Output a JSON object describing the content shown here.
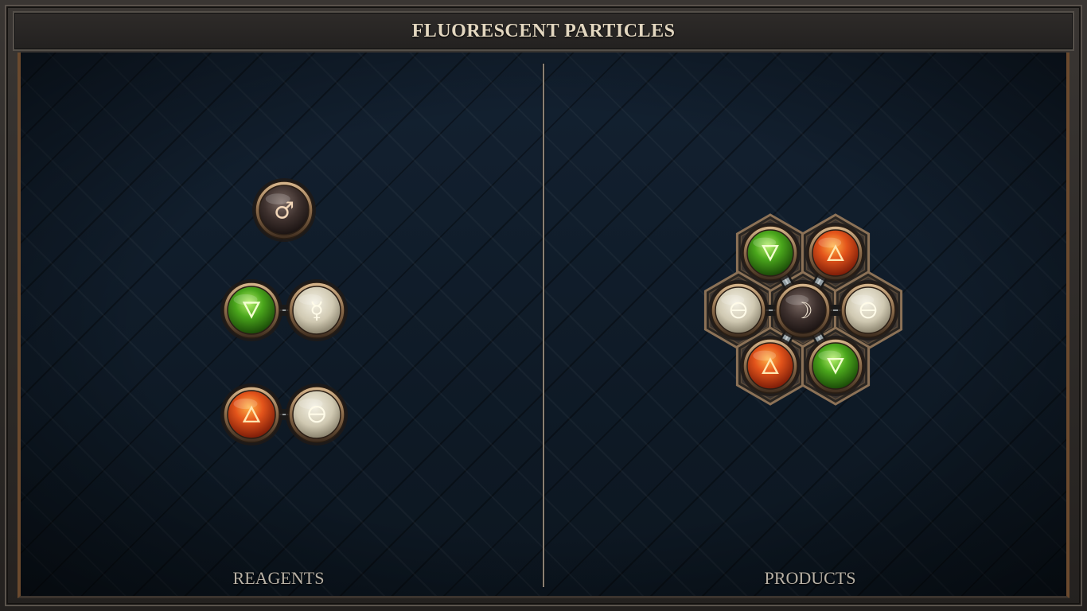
{
  "title": "FLUORESCENT PARTICLES",
  "sections": {
    "reagents_label": "REAGENTS",
    "products_label": "PRODUCTS"
  },
  "colors": {
    "frame": "#2e2b29",
    "board": "#101a25",
    "fire": "#e0531a",
    "water": "#4caa1c",
    "salt": "#d8d2bd",
    "quicksilver": "#d8d2bd",
    "metal": "#3b2f2c",
    "brass": "#a8896a"
  },
  "reagents": [
    {
      "id": "reagent-1",
      "atoms": [
        {
          "element": "iron",
          "symbol": "♂"
        }
      ]
    },
    {
      "id": "reagent-2",
      "atoms": [
        {
          "element": "water",
          "symbol": "🜄"
        },
        {
          "element": "quicksilver",
          "symbol": "☿"
        }
      ]
    },
    {
      "id": "reagent-3",
      "atoms": [
        {
          "element": "fire",
          "symbol": "🜂"
        },
        {
          "element": "salt",
          "symbol": "🜔"
        }
      ]
    }
  ],
  "products": [
    {
      "id": "product-1",
      "atoms": [
        {
          "element": "water",
          "symbol": "🜄"
        },
        {
          "element": "fire",
          "symbol": "🜂"
        },
        {
          "element": "salt",
          "symbol": "🜔"
        },
        {
          "element": "silver",
          "symbol": "☽"
        },
        {
          "element": "salt",
          "symbol": "🜔"
        },
        {
          "element": "fire",
          "symbol": "🜂"
        },
        {
          "element": "water",
          "symbol": "🜄"
        }
      ]
    }
  ]
}
